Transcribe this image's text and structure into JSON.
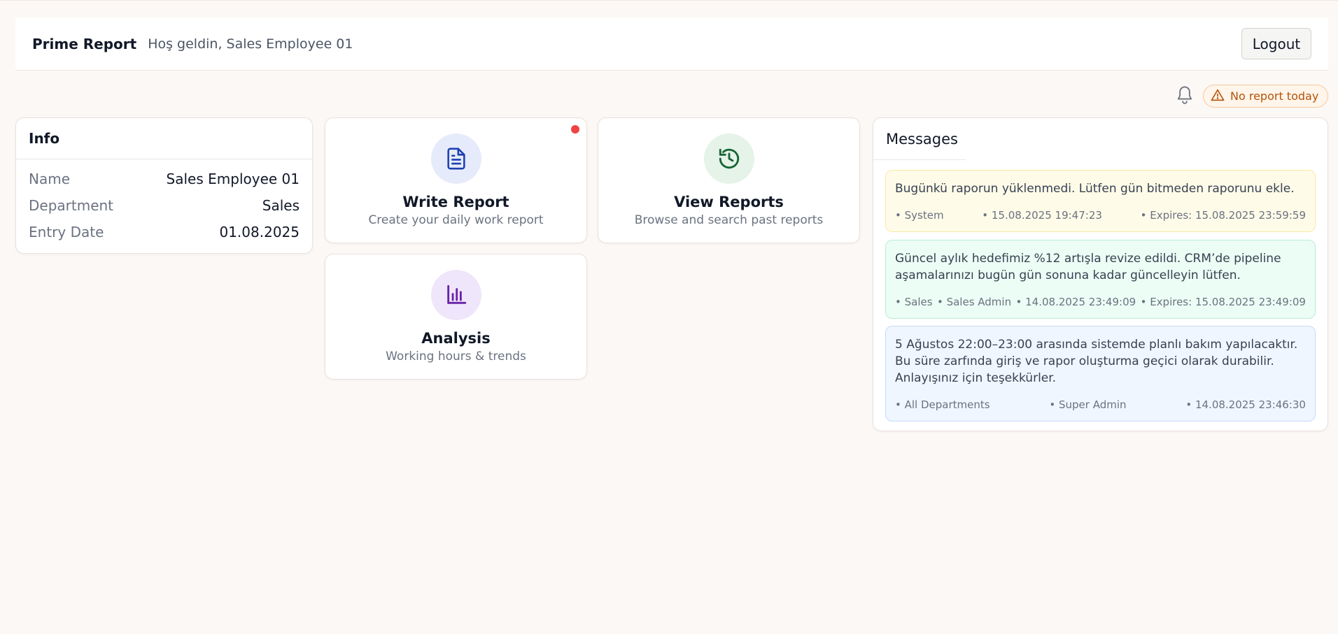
{
  "header": {
    "brand": "Prime Report",
    "welcome": "Hoş geldin, Sales Employee 01",
    "logout_label": "Logout"
  },
  "status": {
    "bell_icon": "bell-icon",
    "warning_icon": "warning-triangle-icon",
    "warning_text": "No report today",
    "warning_color": "#b45309"
  },
  "info": {
    "title": "Info",
    "rows": [
      {
        "label": "Name",
        "value": "Sales Employee 01"
      },
      {
        "label": "Department",
        "value": "Sales"
      },
      {
        "label": "Entry Date",
        "value": "01.08.2025"
      }
    ]
  },
  "actions": {
    "write": {
      "title": "Write Report",
      "subtitle": "Create your daily work report",
      "icon": "document-icon",
      "color": "#1e40af"
    },
    "view": {
      "title": "View Reports",
      "subtitle": "Browse and search past reports",
      "icon": "history-icon",
      "color": "#166534"
    },
    "analysis": {
      "title": "Analysis",
      "subtitle": "Working hours & trends",
      "icon": "bar-chart-icon",
      "color": "#6b21a8"
    }
  },
  "messages": {
    "title": "Messages",
    "items": [
      {
        "text": "Bugünkü raporun yüklenmedi. Lütfen gün bitmeden raporunu ekle.",
        "meta": [
          "• System",
          "• 15.08.2025 19:47:23",
          "• Expires: 15.08.2025 23:59:59"
        ]
      },
      {
        "text": "Güncel aylık hedefimiz %12 artışla revize edildi. CRM’de pipeline aşamalarınızı bugün gün sonuna kadar güncelleyin lütfen.",
        "meta": [
          "• Sales",
          "• Sales Admin",
          "• 14.08.2025 23:49:09",
          "• Expires: 15.08.2025 23:49:09"
        ]
      },
      {
        "text": "5 Ağustos 22:00–23:00 arasında sistemde planlı bakım yapılacaktır. Bu süre zarfında giriş ve rapor oluşturma geçici olarak durabilir. Anlayışınız için teşekkürler.",
        "meta": [
          "• All Departments",
          "• Super Admin",
          "• 14.08.2025 23:46:30"
        ]
      }
    ]
  }
}
